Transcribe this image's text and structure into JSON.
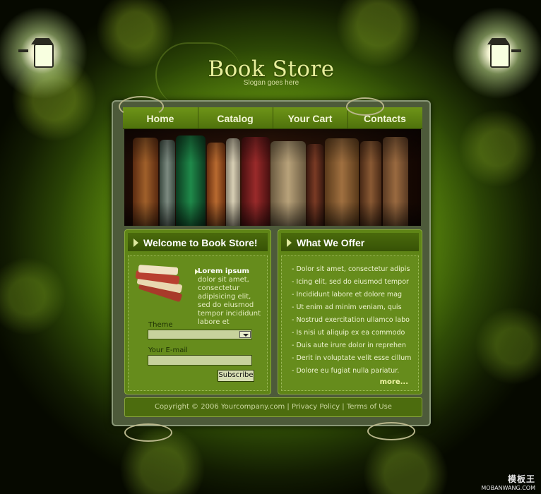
{
  "header": {
    "title": "Book Store",
    "slogan": "Slogan goes here"
  },
  "nav": {
    "items": [
      "Home",
      "Catalog",
      "Your Cart",
      "Contacts"
    ]
  },
  "welcome": {
    "heading": "Welcome to Book Store!",
    "intro_bold": "Lorem ipsum",
    "intro_text": " dolor sit amet, consectetur adipisicing elit, sed do eiusmod tempor incididunt  labore et",
    "theme_label": "Theme",
    "theme_value": "",
    "email_label": "Your E-mail",
    "email_placeholder": "",
    "subscribe_label": "Subscribe"
  },
  "offer": {
    "heading": "What We Offer",
    "items": [
      "Dolor sit amet, consectetur adipis",
      "Icing elit, sed do eiusmod tempor",
      "Incididunt  labore et dolore mag",
      "Ut enim ad minim veniam, quis",
      "Nostrud exercitation ullamco labo",
      "Is nisi ut aliquip ex ea commodo",
      "Duis aute irure dolor in reprehen",
      "Derit in voluptate velit esse cillum",
      "Dolore eu fugiat nulla pariatur."
    ],
    "more_label": "more..."
  },
  "footer": {
    "copyright": "Copyright © 2006 Yourcompany.com",
    "sep1": " | ",
    "privacy": "Privacy Policy",
    "sep2": "  |  ",
    "terms": "Terms of Use"
  },
  "watermark": {
    "main": "模板王",
    "sub": "MOBANWANG.COM"
  },
  "colors": {
    "accent": "#e8ef9c",
    "panel": "#5f8516",
    "nav": "#6e9418",
    "background": "#0d1400"
  }
}
